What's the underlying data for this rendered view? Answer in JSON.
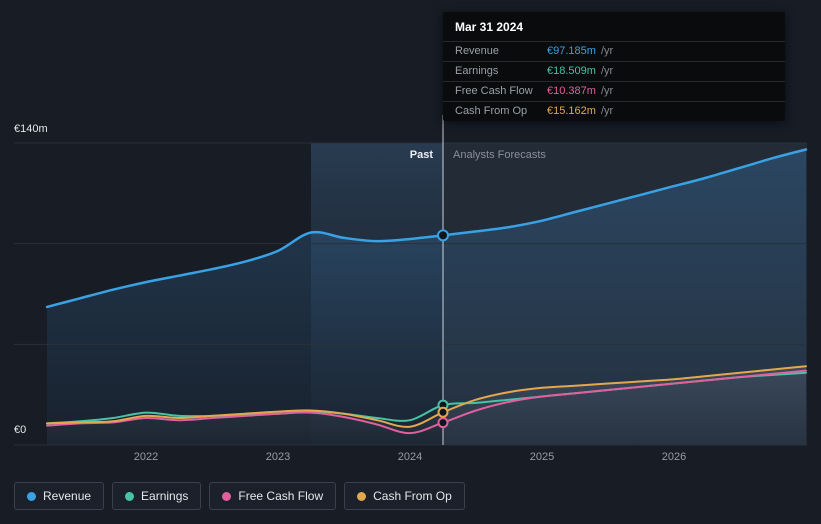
{
  "theme": {
    "page_bg": "#171c25",
    "forecast_bg": "#232b37",
    "grid": "#2a313c",
    "divider": "#e8edf2",
    "revenue": "#39a2e5",
    "earnings": "#46c3a5",
    "free_cash_flow": "#e0609e",
    "cash_from_op": "#e3a84e"
  },
  "tooltip": {
    "date": "Mar 31 2024",
    "rows": [
      {
        "label": "Revenue",
        "value": "€97.185m",
        "suffix": "/yr",
        "color": "#39a2e5"
      },
      {
        "label": "Earnings",
        "value": "€18.509m",
        "suffix": "/yr",
        "color": "#46c3a5"
      },
      {
        "label": "Free Cash Flow",
        "value": "€10.387m",
        "suffix": "/yr",
        "color": "#e0609e"
      },
      {
        "label": "Cash From Op",
        "value": "€15.162m",
        "suffix": "/yr",
        "color": "#e3a84e"
      }
    ]
  },
  "labels": {
    "past": "Past",
    "forecast": "Analysts Forecasts",
    "y_max": "€140m",
    "y_min": "€0"
  },
  "x_axis": [
    "2022",
    "2023",
    "2024",
    "2025",
    "2026"
  ],
  "legend": [
    {
      "label": "Revenue",
      "color": "#39a2e5"
    },
    {
      "label": "Earnings",
      "color": "#46c3a5"
    },
    {
      "label": "Free Cash Flow",
      "color": "#e0609e"
    },
    {
      "label": "Cash From Op",
      "color": "#e3a84e"
    }
  ],
  "chart_data": {
    "type": "line",
    "y_unit": "€m",
    "ylim": [
      0,
      140
    ],
    "xlim": [
      2021.25,
      2027
    ],
    "divider_x": 2024.25,
    "divider_date": "Mar 31 2024",
    "highlight_band_x": [
      2023.25,
      2024.25
    ],
    "x_years": [
      2021.25,
      2021.5,
      2021.75,
      2022,
      2022.25,
      2022.5,
      2022.75,
      2023,
      2023.25,
      2023.5,
      2023.75,
      2024,
      2024.25,
      2024.5,
      2024.75,
      2025,
      2025.25,
      2025.5,
      2025.75,
      2026,
      2026.25,
      2026.5,
      2026.75,
      2027
    ],
    "series": [
      {
        "name": "Revenue",
        "color": "#39a2e5",
        "width": 2.5,
        "values": [
          64,
          68,
          72,
          75.5,
          78.5,
          81.5,
          85,
          90,
          98.5,
          96,
          94.5,
          95.5,
          97.185,
          99,
          101,
          104,
          108,
          112,
          116,
          120,
          124,
          128.5,
          133,
          137
        ]
      },
      {
        "name": "Earnings",
        "color": "#46c3a5",
        "width": 2,
        "values": [
          10,
          11,
          12.5,
          15,
          13.5,
          13.5,
          14,
          14.5,
          15.5,
          14.5,
          12.5,
          11.5,
          18.509,
          19.5,
          21,
          22.5,
          24,
          25.5,
          27,
          28.5,
          30,
          31.5,
          32.5,
          33.5
        ]
      },
      {
        "name": "Free Cash Flow",
        "color": "#e0609e",
        "width": 2,
        "values": [
          9,
          10,
          10.5,
          12.5,
          11.5,
          12.5,
          13.5,
          14.5,
          15,
          13,
          9.5,
          5.5,
          10.387,
          16,
          20,
          22.5,
          24,
          25.5,
          27,
          28.5,
          30,
          31.5,
          33,
          34.5
        ]
      },
      {
        "name": "Cash From Op",
        "color": "#e3a84e",
        "width": 2,
        "values": [
          10,
          10.5,
          11,
          13.5,
          12.5,
          13.5,
          14.5,
          15.5,
          16,
          14.5,
          11.5,
          8.5,
          15.162,
          21,
          24.5,
          26.5,
          27.5,
          28.5,
          29.5,
          30.5,
          32,
          33.5,
          35,
          36.5
        ]
      }
    ],
    "legend_position": "bottom-left",
    "grid": "horizontal-thirds"
  }
}
